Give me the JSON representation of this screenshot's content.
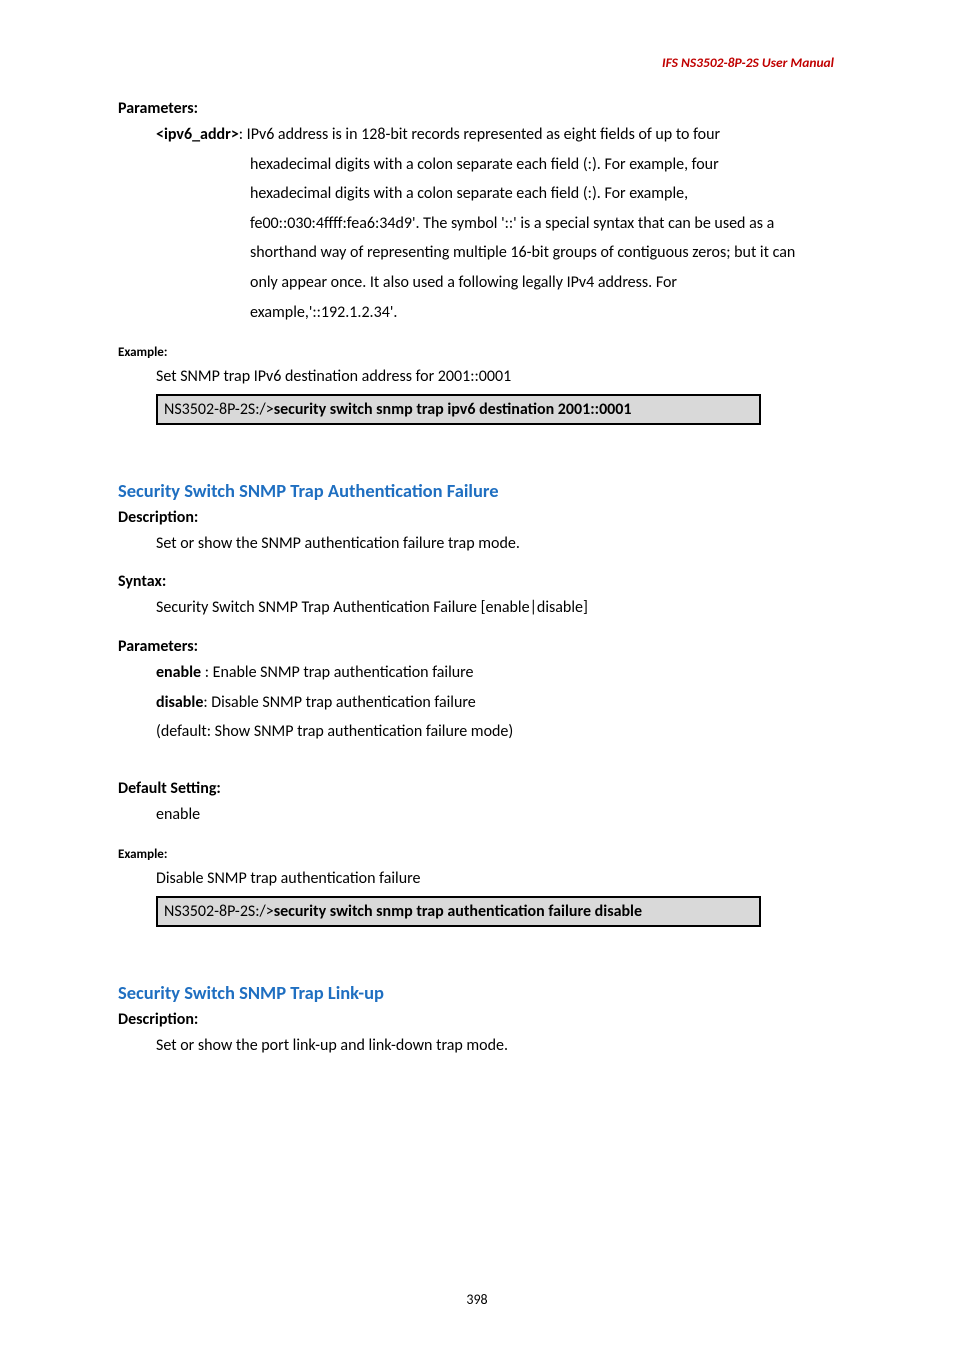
{
  "header": {
    "product": "IFS  NS3502-8P-2S  User  Manual"
  },
  "parametersSection": {
    "label": "Parameters:",
    "paramName": "<ipv6_addr>",
    "paramIntro": ": IPv6 address is in 128-bit records represented as eight fields of up to four",
    "paramBody1": "hexadecimal digits with a colon separate each field (:). For example, four",
    "paramBody2": "hexadecimal digits with a colon separate each field (:). For example,",
    "paramBody3": "fe00::030:4ffff:fea6:34d9'. The symbol '::' is a special syntax that can be used as a",
    "paramBody4": "shorthand way of representing multiple 16-bit groups of contiguous zeros; but it can",
    "paramBody5": "only appear once. It also used a following legally IPv4 address. For",
    "paramBody6": "example,'::192.1.2.34'."
  },
  "example1": {
    "label": "Example:",
    "line": "Set SNMP trap IPv6 destination address for 2001::0001",
    "cmdPrompt": "NS3502-8P-2S:/>",
    "cmdBold": "security switch snmp trap ipv6 destination 2001::0001"
  },
  "authFailure": {
    "heading": "Security Switch SNMP Trap Authentication Failure",
    "descLabel": "Description:",
    "descText": "Set or show the SNMP authentication failure trap mode.",
    "syntaxLabel": "Syntax:",
    "syntaxText": "Security Switch SNMP Trap Authentication Failure [enable|disable]",
    "paramsLabel": "Parameters:",
    "enableBold": "enable",
    "enableRest": " : Enable SNMP trap authentication failure",
    "disableBold": "disable",
    "disableRest": ": Disable SNMP trap authentication failure",
    "defaultLine": "(default: Show SNMP trap authentication failure mode)",
    "defSettingLabel": "Default Setting:",
    "defSettingText": "enable",
    "exampleLabel": "Example:",
    "exampleLine": "Disable SNMP trap authentication failure",
    "cmdPrompt": "NS3502-8P-2S:/>",
    "cmdBold": "security switch snmp trap authentication failure disable"
  },
  "linkUp": {
    "heading": "Security Switch SNMP Trap Link-up",
    "descLabel": "Description:",
    "descText": "Set or show the port link-up and link-down trap mode."
  },
  "pageNumber": "398"
}
